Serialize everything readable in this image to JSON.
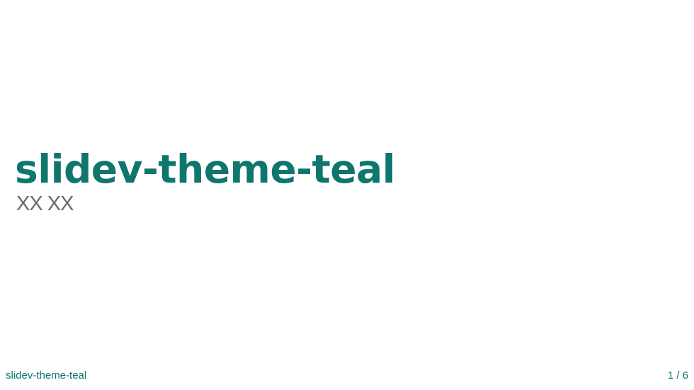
{
  "slide": {
    "title": "slidev-theme-teal",
    "subtitle": "XX XX"
  },
  "footer": {
    "title": "slidev-theme-teal",
    "page_indicator": "1 / 6"
  },
  "colors": {
    "accent": "#0f766e",
    "subtitle": "#6b6b6b",
    "background": "#ffffff"
  }
}
